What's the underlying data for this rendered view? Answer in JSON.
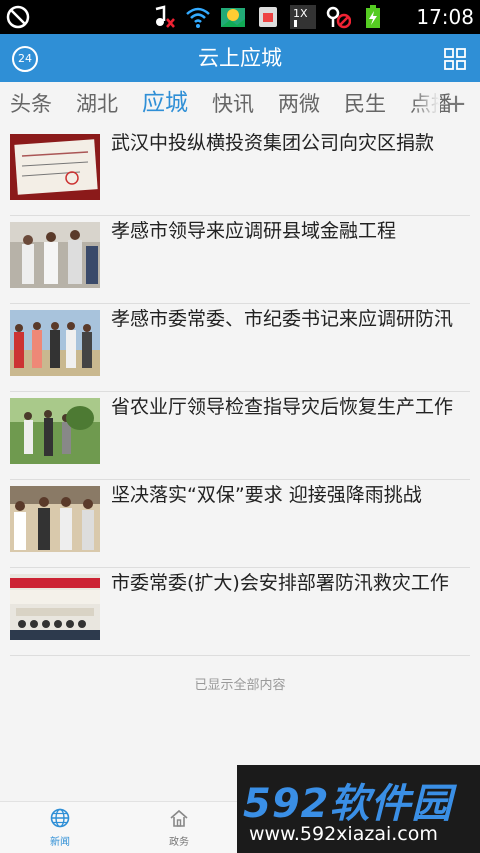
{
  "status_bar": {
    "time": "17:08",
    "icons": [
      "no-disturb-icon",
      "music-muted-icon",
      "wifi-icon",
      "photo-icon",
      "sim-card-icon",
      "network-1x-icon",
      "gps-off-icon",
      "battery-charging-icon"
    ]
  },
  "header": {
    "title": "云上应城",
    "left_badge": "24"
  },
  "tabs": [
    {
      "label": "头条"
    },
    {
      "label": "湖北"
    },
    {
      "label": "应城",
      "active": true
    },
    {
      "label": "快讯"
    },
    {
      "label": "两微"
    },
    {
      "label": "民生"
    },
    {
      "label": "点播"
    }
  ],
  "news": [
    {
      "title": "武汉中投纵横投资集团公司向灾区捐款"
    },
    {
      "title": "孝感市领导来应调研县域金融工程"
    },
    {
      "title": "孝感市委常委、市纪委书记来应调研防汛"
    },
    {
      "title": "省农业厅领导检查指导灾后恢复生产工作"
    },
    {
      "title": "坚决落实“双保”要求 迎接强降雨挑战"
    },
    {
      "title": "市委常委(扩大)会安排部署防汛救灾工作"
    }
  ],
  "list_end_message": "已显示全部内容",
  "bottom_nav": [
    {
      "label": "新闻",
      "icon": "globe-icon",
      "active": true
    },
    {
      "label": "政务",
      "icon": "home-icon",
      "active": false
    }
  ],
  "watermark": {
    "logo": "592软件园",
    "url": "www.592xiazai.com"
  },
  "colors": {
    "primary": "#2f8fd6",
    "background": "#f4f4f4"
  }
}
